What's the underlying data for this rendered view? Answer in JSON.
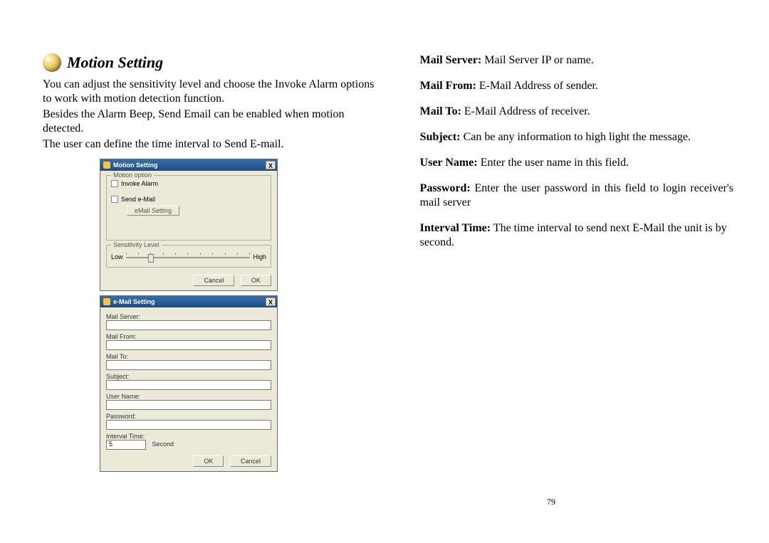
{
  "heading": "Motion Setting",
  "paragraphs": {
    "p1": "You can adjust the sensitivity level and choose the Invoke Alarm options to work with motion detection function.",
    "p2": "Besides the Alarm Beep, Send Email can be enabled when motion detected.",
    "p3": "The user can define the time interval to Send E-mail."
  },
  "dialog1": {
    "title": "Motion Setting",
    "close": "X",
    "group_motion": "Motion option",
    "chk_invoke": "Invoke Alarm",
    "chk_send": "Send e-Mail",
    "btn_email": "eMail Setting",
    "group_sens": "Sensitivity Level",
    "low": "Low",
    "high": "High",
    "cancel": "Cancel",
    "ok": "OK"
  },
  "dialog2": {
    "title": "e-Mail Setting",
    "close": "X",
    "labels": {
      "server": "Mail Server:",
      "from": "Mail From:",
      "to": "Mail To:",
      "subject": "Subject:",
      "user": "User Name:",
      "password": "Password:",
      "interval": "Interval Time:"
    },
    "interval_value": "5",
    "unit": "Second",
    "ok": "OK",
    "cancel": "Cancel"
  },
  "definitions": {
    "server_t": "Mail Server:",
    "server_d": " Mail Server IP or name.",
    "from_t": "Mail From:",
    "from_d": " E-Mail Address of sender.",
    "to_t": "Mail To:",
    "to_d": " E-Mail Address of receiver.",
    "subject_t": "Subject:",
    "subject_d": " Can be any information to high light the message.",
    "user_t": "User Name:",
    "user_d": " Enter the user name in this field.",
    "password_t": "Password:",
    "password_d": " Enter the user password in this field to login receiver's mail server",
    "interval_t": "Interval Time:",
    "interval_d": " The time interval to send next E-Mail the unit is by second."
  },
  "page_number": "79"
}
